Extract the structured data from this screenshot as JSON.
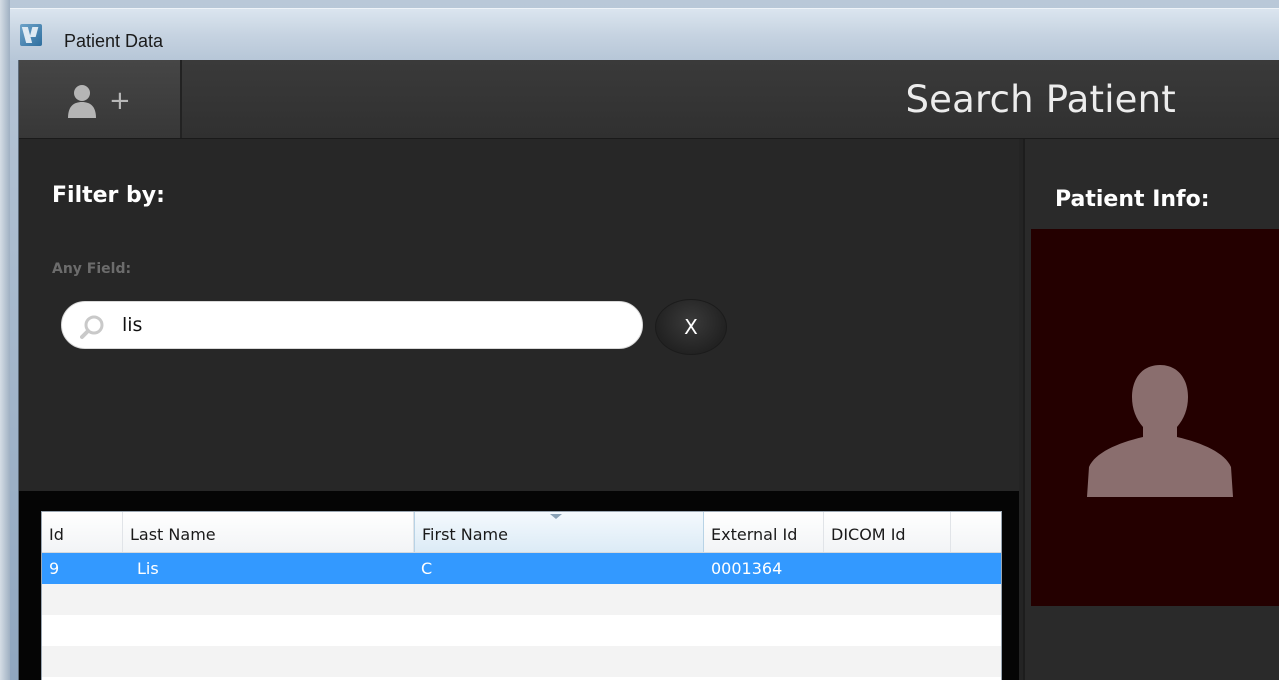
{
  "window": {
    "title": "Patient Data"
  },
  "toolbar": {
    "add_patient_plus": "+",
    "page_title": "Search Patient"
  },
  "filter": {
    "heading": "Filter by:",
    "any_field_label": "Any Field:",
    "search_value": "lis",
    "clear_label": "X"
  },
  "table": {
    "columns": [
      "Id",
      "Last Name",
      "First Name",
      "External Id",
      "DICOM Id"
    ],
    "sorted_column": "First Name",
    "rows": [
      {
        "id": "9",
        "last_name": "Lis",
        "first_name": "C",
        "external_id": "0001364",
        "dicom_id": ""
      }
    ]
  },
  "patient_info": {
    "heading": "Patient Info:"
  },
  "colors": {
    "selection": "#3399ff",
    "photo_background": "#240000",
    "avatar": "#8a6e6e"
  },
  "icons": [
    "app-icon",
    "add-person-icon",
    "search-icon",
    "person-silhouette-icon"
  ]
}
